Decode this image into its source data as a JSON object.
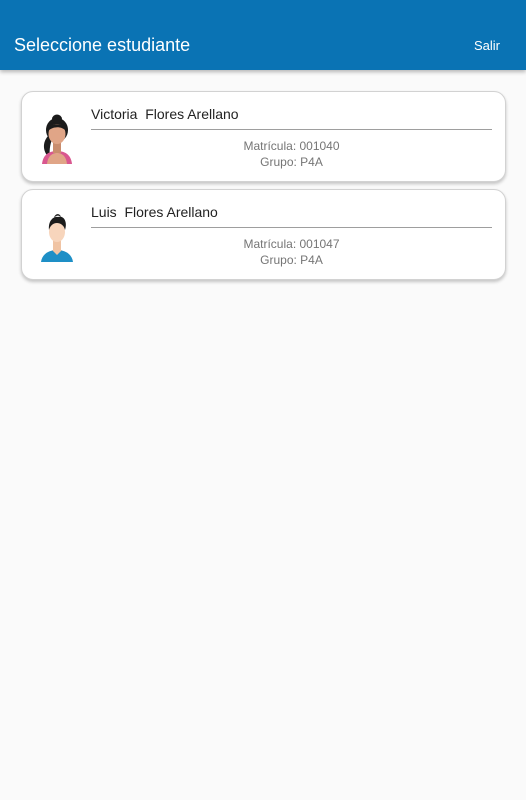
{
  "app_bar": {
    "title": "Seleccione estudiante",
    "logout_label": "Salir",
    "background_color": "#0a73b4"
  },
  "students": [
    {
      "name": "Victoria  Flores Arellano",
      "enrollment": "Matrícula: 001040",
      "group": "Grupo: P4A",
      "avatar_icon": "female-student-avatar-icon"
    },
    {
      "name": "Luis  Flores Arellano",
      "enrollment": "Matrícula: 001047",
      "group": "Grupo: P4A",
      "avatar_icon": "male-student-avatar-icon"
    }
  ]
}
